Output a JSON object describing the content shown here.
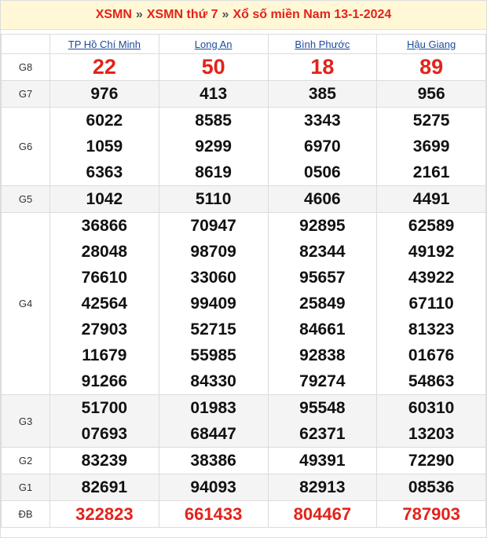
{
  "breadcrumb": {
    "root": "XSMN",
    "sep1": "»",
    "day": "XSMN thứ 7",
    "sep2": "»",
    "title": "Xổ số miền Nam 13-1-2024"
  },
  "provinces": [
    "TP Hồ Chí Minh",
    "Long An",
    "Bình Phước",
    "Hậu Giang"
  ],
  "prizes": [
    {
      "label": "G8",
      "results": [
        [
          "22"
        ],
        [
          "50"
        ],
        [
          "18"
        ],
        [
          "89"
        ]
      ]
    },
    {
      "label": "G7",
      "results": [
        [
          "976"
        ],
        [
          "413"
        ],
        [
          "385"
        ],
        [
          "956"
        ]
      ]
    },
    {
      "label": "G6",
      "results": [
        [
          "6022",
          "1059",
          "6363"
        ],
        [
          "8585",
          "9299",
          "8619"
        ],
        [
          "3343",
          "6970",
          "0506"
        ],
        [
          "5275",
          "3699",
          "2161"
        ]
      ]
    },
    {
      "label": "G5",
      "results": [
        [
          "1042"
        ],
        [
          "5110"
        ],
        [
          "4606"
        ],
        [
          "4491"
        ]
      ]
    },
    {
      "label": "G4",
      "results": [
        [
          "36866",
          "28048",
          "76610",
          "42564",
          "27903",
          "11679",
          "91266"
        ],
        [
          "70947",
          "98709",
          "33060",
          "99409",
          "52715",
          "55985",
          "84330"
        ],
        [
          "92895",
          "82344",
          "95657",
          "25849",
          "84661",
          "92838",
          "79274"
        ],
        [
          "62589",
          "49192",
          "43922",
          "67110",
          "81323",
          "01676",
          "54863"
        ]
      ]
    },
    {
      "label": "G3",
      "results": [
        [
          "51700",
          "07693"
        ],
        [
          "01983",
          "68447"
        ],
        [
          "95548",
          "62371"
        ],
        [
          "60310",
          "13203"
        ]
      ]
    },
    {
      "label": "G2",
      "results": [
        [
          "83239"
        ],
        [
          "38386"
        ],
        [
          "49391"
        ],
        [
          "72290"
        ]
      ]
    },
    {
      "label": "G1",
      "results": [
        [
          "82691"
        ],
        [
          "94093"
        ],
        [
          "82913"
        ],
        [
          "08536"
        ]
      ]
    },
    {
      "label": "ĐB",
      "results": [
        [
          "322823"
        ],
        [
          "661433"
        ],
        [
          "804467"
        ],
        [
          "787903"
        ]
      ]
    }
  ],
  "colors": {
    "accent": "#e2231a",
    "link": "#1a4a9e",
    "header_bg": "#fff7d6"
  }
}
